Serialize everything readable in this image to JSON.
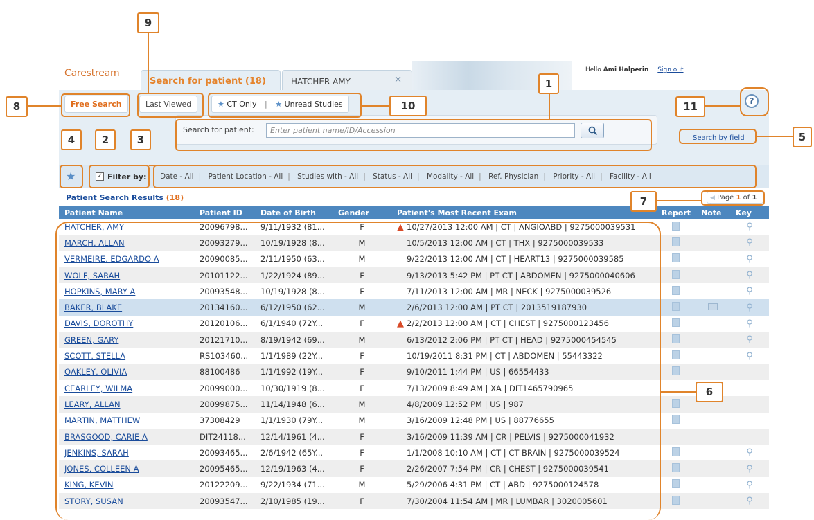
{
  "header": {
    "logo": "Carestream",
    "tab_search": "Search for patient (18)",
    "tab_patient": "HATCHER AMY",
    "hello_prefix": "Hello",
    "user_name": "Ami Halperin",
    "sign_out": "Sign out"
  },
  "quick": {
    "free_search": "Free Search",
    "last_viewed": "Last Viewed",
    "ct_only": "CT Only",
    "separator": "|",
    "unread_studies": "Unread Studies"
  },
  "search": {
    "label": "Search for patient:",
    "placeholder": "Enter patient name/ID/Accession",
    "by_field": "Search by field"
  },
  "filter": {
    "label": "Filter by:",
    "items": [
      "Date - All",
      "Patient Location - All",
      "Studies with - All",
      "Status - All",
      "Modality - All",
      "Ref. Physician",
      "Priority - All",
      "Facility - All"
    ]
  },
  "results": {
    "title": "Patient Search Results",
    "count": "(18)",
    "pager_prefix": "Page",
    "page": "1",
    "pager_of": "of",
    "total_pages": "1"
  },
  "table": {
    "headers": [
      "Patient Name",
      "Patient ID",
      "Date of Birth",
      "Gender",
      "Patient's Most Recent Exam",
      "Report",
      "Note",
      "Key"
    ],
    "rows": [
      {
        "name": "HATCHER, AMY",
        "id": "20096798...",
        "dob": "9/11/1932 (81...",
        "gender": "F",
        "exam": "10/27/2013 12:00 AM | CT | ANGIOABD | 9275000039531",
        "warn": true,
        "report": true,
        "note": false,
        "key": true
      },
      {
        "name": "MARCH, ALLAN",
        "id": "20093279...",
        "dob": "10/19/1928 (8...",
        "gender": "M",
        "exam": "10/5/2013 12:00 AM | CT | THX | 9275000039533",
        "warn": false,
        "report": true,
        "note": false,
        "key": true
      },
      {
        "name": "VERMEIRE, EDGARDO A",
        "id": "20090085...",
        "dob": "2/11/1950 (63...",
        "gender": "M",
        "exam": "9/22/2013 12:00 AM | CT | HEART13 | 9275000039585",
        "warn": false,
        "report": true,
        "note": false,
        "key": true
      },
      {
        "name": "WOLF, SARAH",
        "id": "20101122...",
        "dob": "1/22/1924 (89...",
        "gender": "F",
        "exam": "9/13/2013 5:42 PM | PT CT | ABDOMEN | 9275000040606",
        "warn": false,
        "report": true,
        "note": false,
        "key": true
      },
      {
        "name": "HOPKINS, MARY A",
        "id": "20093548...",
        "dob": "10/19/1928 (8...",
        "gender": "F",
        "exam": "7/11/2013 12:00 AM | MR | NECK | 9275000039526",
        "warn": false,
        "report": true,
        "note": false,
        "key": true
      },
      {
        "name": "BAKER, BLAKE",
        "id": "20134160...",
        "dob": "6/12/1950 (62...",
        "gender": "M",
        "exam": "2/6/2013 12:00 AM | PT CT | 2013519187930",
        "warn": false,
        "report": true,
        "note": true,
        "key": true,
        "selected": true
      },
      {
        "name": "DAVIS, DOROTHY",
        "id": "20120106...",
        "dob": "6/1/1940 (72Y...",
        "gender": "F",
        "exam": "2/2/2013 12:00 AM | CT | CHEST | 9275000123456",
        "warn": true,
        "report": true,
        "note": false,
        "key": true
      },
      {
        "name": "GREEN, GARY",
        "id": "20121710...",
        "dob": "8/19/1942 (69...",
        "gender": "M",
        "exam": "6/13/2012 2:06 PM | PT CT | HEAD | 9275000454545",
        "warn": false,
        "report": true,
        "note": false,
        "key": true
      },
      {
        "name": "SCOTT, STELLA",
        "id": "RS103460...",
        "dob": "1/1/1989 (22Y...",
        "gender": "F",
        "exam": "10/19/2011 8:31 PM | CT | ABDOMEN | 55443322",
        "warn": false,
        "report": true,
        "note": false,
        "key": true
      },
      {
        "name": "OAKLEY, OLIVIA",
        "id": "88100486",
        "dob": "1/1/1992 (19Y...",
        "gender": "F",
        "exam": "9/10/2011 1:44 PM | US | 66554433",
        "warn": false,
        "report": true,
        "note": false,
        "key": false
      },
      {
        "name": "CEARLEY, WILMA",
        "id": "20099000...",
        "dob": "10/30/1919 (8...",
        "gender": "F",
        "exam": "7/13/2009 8:49 AM | XA | DIT1465790965",
        "warn": false,
        "report": false,
        "note": false,
        "key": false
      },
      {
        "name": "LEARY, ALLAN",
        "id": "20099875...",
        "dob": "11/14/1948 (6...",
        "gender": "M",
        "exam": "4/8/2009 12:52 PM | US | 987",
        "warn": false,
        "report": true,
        "note": false,
        "key": false
      },
      {
        "name": "MARTIN, MATTHEW",
        "id": "37308429",
        "dob": "1/1/1930 (79Y...",
        "gender": "M",
        "exam": "3/16/2009 12:48 PM | US | 88776655",
        "warn": false,
        "report": true,
        "note": false,
        "key": false
      },
      {
        "name": "BRASGOOD, CARIE A",
        "id": "DIT24118...",
        "dob": "12/14/1961 (4...",
        "gender": "F",
        "exam": "3/16/2009 11:39 AM | CR | PELVIS | 9275000041932",
        "warn": false,
        "report": false,
        "note": false,
        "key": false
      },
      {
        "name": "JENKINS, SARAH",
        "id": "20093465...",
        "dob": "2/6/1942 (65Y...",
        "gender": "F",
        "exam": "1/1/2008 10:10 AM | CT | CT BRAIN | 9275000039524",
        "warn": false,
        "report": true,
        "note": false,
        "key": true
      },
      {
        "name": "JONES, COLLEEN A",
        "id": "20095465...",
        "dob": "12/19/1963 (4...",
        "gender": "F",
        "exam": "2/26/2007 7:54 PM | CR | CHEST | 9275000039541",
        "warn": false,
        "report": true,
        "note": false,
        "key": true
      },
      {
        "name": "KING, KEVIN",
        "id": "20122209...",
        "dob": "9/22/1934 (71...",
        "gender": "M",
        "exam": "5/29/2006 4:31 PM | CT | ABD | 9275000124578",
        "warn": false,
        "report": true,
        "note": false,
        "key": true
      },
      {
        "name": "STORY, SUSAN",
        "id": "20093547...",
        "dob": "2/10/1985 (19...",
        "gender": "F",
        "exam": "7/30/2004 11:54 AM | MR | LUMBAR | 3020005601",
        "warn": false,
        "report": true,
        "note": false,
        "key": true
      }
    ]
  },
  "annotations": [
    "1",
    "2",
    "3",
    "4",
    "5",
    "6",
    "7",
    "8",
    "9",
    "10",
    "11"
  ],
  "colors": {
    "accent_orange": "#e0842b",
    "header_blue": "#4d87bf",
    "link_blue": "#1a4c9b",
    "panel_bg": "#e5eef5",
    "warning_red": "#d84a27"
  },
  "icons": {
    "search": "magnifier-icon",
    "help": "help-icon",
    "favorite": "star-icon",
    "warning": "warning-icon",
    "report": "document-icon",
    "note": "note-icon",
    "key": "key-icon",
    "pager_prev": "triangle-left",
    "pager_next": "triangle-right"
  }
}
